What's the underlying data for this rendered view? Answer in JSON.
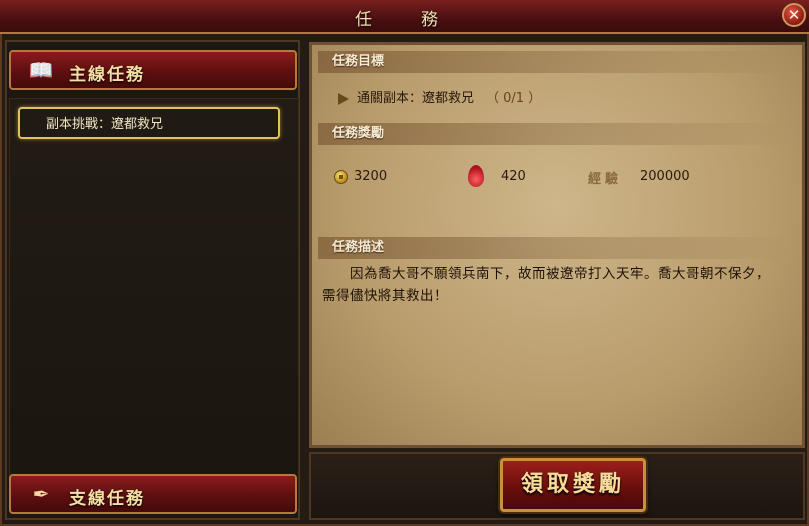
{
  "window": {
    "title": "任　務",
    "close_symbol": "✕"
  },
  "left": {
    "main_category": {
      "label": "主線任務",
      "icon": "scroll-book-icon"
    },
    "quests": [
      {
        "label": "副本挑戰：遼都救兄"
      }
    ],
    "side_category": {
      "label": "支線任務",
      "icon": "quill-icon"
    }
  },
  "right": {
    "objective": {
      "heading": "任務目標",
      "text": "通關副本：遼都救兄",
      "progress": "（ 0/1 ）"
    },
    "rewards": {
      "heading": "任務獎勵",
      "gold": "3200",
      "spirit": "420",
      "exp_label": "經驗",
      "exp": "200000"
    },
    "description": {
      "heading": "任務描述",
      "text": "因為喬大哥不願領兵南下，故而被遼帝打入天牢。喬大哥朝不保夕，需得儘快將其救出！"
    }
  },
  "actions": {
    "claim_label": "領取獎勵"
  },
  "colors": {
    "accent_red": "#8a1c1c",
    "gold_border": "#c5913a",
    "parchment": "#cdb68a"
  }
}
